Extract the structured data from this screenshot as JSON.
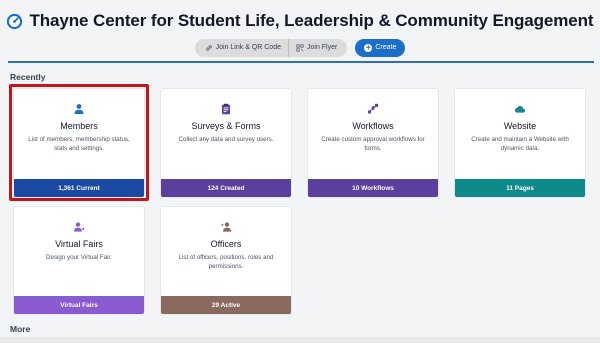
{
  "header": {
    "title": "Thayne Center for Student Life, Leadership & Community Engagement",
    "join_link_label": "Join Link & QR Code",
    "join_flyer_label": "Join Flyer",
    "create_label": "Create"
  },
  "sections": {
    "recently": "Recently",
    "more": "More"
  },
  "cards": [
    {
      "title": "Members",
      "desc": "List of members, membership status, stats and settings.",
      "footer": "1,361 Current",
      "icon": "member-icon"
    },
    {
      "title": "Surveys & Forms",
      "desc": "Collect any data and survey users.",
      "footer": "124 Created",
      "icon": "clipboard-icon"
    },
    {
      "title": "Workflows",
      "desc": "Create custom approval workflows for forms.",
      "footer": "10 Workflows",
      "icon": "workflow-icon"
    },
    {
      "title": "Website",
      "desc": "Create and maintain a Website with dynamic data.",
      "footer": "11 Pages",
      "icon": "cloud-icon"
    },
    {
      "title": "Virtual Fairs",
      "desc": "Design your Virtual Fair.",
      "footer": "Virtual Fairs",
      "icon": "virtual-fair-icon"
    },
    {
      "title": "Officers",
      "desc": "List of officers, positions, roles and permissions.",
      "footer": "29 Active",
      "icon": "officers-icon"
    }
  ],
  "colors": {
    "members_footer": "#1b4aa5",
    "surveys_footer": "#5b3f9c",
    "workflows_footer": "#5b3f9c",
    "website_footer": "#0f8a8a",
    "virtual_fairs_footer": "#8a5bd0",
    "officers_footer": "#8a6a5f",
    "accent": "#1c6fc9",
    "highlight": "#c0161c"
  }
}
